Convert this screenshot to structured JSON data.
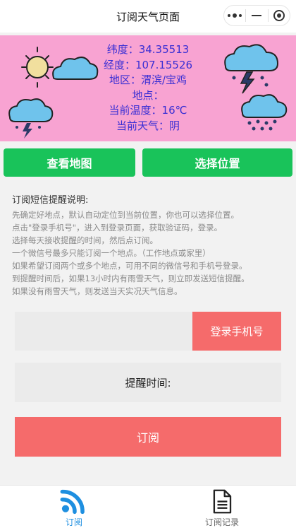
{
  "navbar": {
    "title": "订阅天气页面"
  },
  "weather": {
    "latitude": "纬度：34.35513",
    "longitude": "经度：107.15526",
    "region": "地区：渭滨/宝鸡",
    "place": "地点：",
    "temperature": "当前温度：16℃",
    "condition": "当前天气：阴"
  },
  "buttons": {
    "view_map": "查看地图",
    "choose_location": "选择位置",
    "login_phone": "登录手机号",
    "subscribe": "订阅"
  },
  "description": {
    "title": "订阅短信提醒说明:",
    "lines": [
      "先确定好地点，默认自动定位到当前位置，你也可以选择位置。",
      "点击\"登录手机号\"，进入到登录页面，获取验证码，登录。",
      "选择每天接收提醒的时间，然后点订阅。",
      "一个微信号最多只能订阅一个地点。（工作地点或家里）",
      "如果希望订阅两个或多个地点，可用不同的微信号和手机号登录。",
      "到提醒时间后，如果13小时内有雨雪天气，则立即发送短信提醒。",
      "如果没有雨雪天气，则发送当天实况天气信息。"
    ]
  },
  "remind": {
    "label": "提醒时间:"
  },
  "tabs": [
    {
      "label": "订阅",
      "icon": "wifi-icon",
      "active": true
    },
    {
      "label": "订阅记录",
      "icon": "document-icon",
      "active": false
    }
  ],
  "colors": {
    "banner": "#f8a3d2",
    "info_text": "#3a2fd4",
    "green": "#19c35a",
    "red": "#f56b6b",
    "tab_active": "#1e8fe0"
  }
}
